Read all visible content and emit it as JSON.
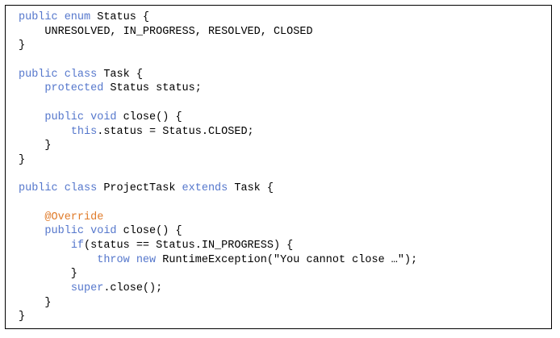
{
  "colors": {
    "keyword": "#5577cc",
    "annotation": "#e07b2a",
    "text": "#000000",
    "border": "#000000",
    "background": "#ffffff"
  },
  "code": {
    "lines": [
      [
        {
          "t": "kw",
          "v": "public enum"
        },
        {
          "t": "txt",
          "v": " Status {"
        }
      ],
      [
        {
          "t": "txt",
          "v": "    UNRESOLVED, IN_PROGRESS, RESOLVED, CLOSED"
        }
      ],
      [
        {
          "t": "txt",
          "v": "}"
        }
      ],
      [],
      [
        {
          "t": "kw",
          "v": "public class"
        },
        {
          "t": "txt",
          "v": " Task {"
        }
      ],
      [
        {
          "t": "txt",
          "v": "    "
        },
        {
          "t": "kw",
          "v": "protected"
        },
        {
          "t": "txt",
          "v": " Status status;"
        }
      ],
      [],
      [
        {
          "t": "txt",
          "v": "    "
        },
        {
          "t": "kw",
          "v": "public void"
        },
        {
          "t": "txt",
          "v": " close() {"
        }
      ],
      [
        {
          "t": "txt",
          "v": "        "
        },
        {
          "t": "kw",
          "v": "this"
        },
        {
          "t": "txt",
          "v": ".status = Status.CLOSED;"
        }
      ],
      [
        {
          "t": "txt",
          "v": "    }"
        }
      ],
      [
        {
          "t": "txt",
          "v": "}"
        }
      ],
      [],
      [
        {
          "t": "kw",
          "v": "public class"
        },
        {
          "t": "txt",
          "v": " ProjectTask "
        },
        {
          "t": "kw",
          "v": "extends"
        },
        {
          "t": "txt",
          "v": " Task {"
        }
      ],
      [],
      [
        {
          "t": "txt",
          "v": "    "
        },
        {
          "t": "ann",
          "v": "@Override"
        }
      ],
      [
        {
          "t": "txt",
          "v": "    "
        },
        {
          "t": "kw",
          "v": "public void"
        },
        {
          "t": "txt",
          "v": " close() {"
        }
      ],
      [
        {
          "t": "txt",
          "v": "        "
        },
        {
          "t": "kw",
          "v": "if"
        },
        {
          "t": "txt",
          "v": "(status == Status.IN_PROGRESS) {"
        }
      ],
      [
        {
          "t": "txt",
          "v": "            "
        },
        {
          "t": "kw",
          "v": "throw new"
        },
        {
          "t": "txt",
          "v": " RuntimeException(\"You cannot close …\");"
        }
      ],
      [
        {
          "t": "txt",
          "v": "        }"
        }
      ],
      [
        {
          "t": "txt",
          "v": "        "
        },
        {
          "t": "kw",
          "v": "super"
        },
        {
          "t": "txt",
          "v": ".close();"
        }
      ],
      [
        {
          "t": "txt",
          "v": "    }"
        }
      ],
      [
        {
          "t": "txt",
          "v": "}"
        }
      ]
    ]
  }
}
